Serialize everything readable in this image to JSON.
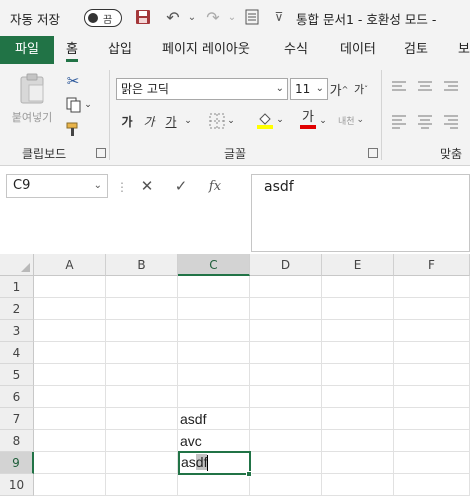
{
  "titlebar": {
    "autosave_label": "자동 저장",
    "autosave_toggle": "끔",
    "document_title": "통합 문서1 - 호환성 모드 -"
  },
  "tabs": [
    {
      "label": "파일"
    },
    {
      "label": "홈"
    },
    {
      "label": "삽입"
    },
    {
      "label": "페이지 레이아웃"
    },
    {
      "label": "수식"
    },
    {
      "label": "데이터"
    },
    {
      "label": "검토"
    },
    {
      "label": "보"
    }
  ],
  "ribbon": {
    "clipboard": {
      "paste_label": "붙여넣기",
      "group_label": "클립보드"
    },
    "font": {
      "font_name": "맑은 고딕",
      "font_size": "11",
      "grow_label": "가",
      "shrink_label": "가",
      "bold": "가",
      "italic": "가",
      "underline": "가",
      "font_color": "가",
      "phonetic_label": "내천",
      "group_label": "글꼴"
    },
    "alignment": {
      "group_label": "맞춤"
    }
  },
  "formula_bar": {
    "name_box": "C9",
    "formula": "asdf",
    "fx_label": "fx"
  },
  "grid": {
    "columns": [
      "A",
      "B",
      "C",
      "D",
      "E",
      "F"
    ],
    "rows": [
      "1",
      "2",
      "3",
      "4",
      "5",
      "6",
      "7",
      "8",
      "9",
      "10"
    ],
    "selected_column": "C",
    "selected_row": "9",
    "cells": {
      "C7": "asdf",
      "C8": "avc",
      "C9_before": "as",
      "C9_selected": "df"
    }
  },
  "colors": {
    "accent": "#217346",
    "chrome": "#f3f3f3",
    "save_icon": "#a4373a"
  }
}
